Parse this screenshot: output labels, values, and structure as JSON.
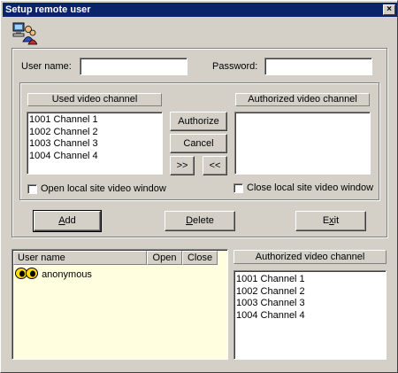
{
  "window": {
    "title": "Setup remote user",
    "close_glyph": "×"
  },
  "form": {
    "username_label": "User name:",
    "username_value": "",
    "password_label": "Password:",
    "password_value": ""
  },
  "used_channels": {
    "header": "Used video channel",
    "items": [
      "1001 Channel 1",
      "1002 Channel 2",
      "1003 Channel 3",
      "1004 Channel 4"
    ]
  },
  "authorized_channels_top": {
    "header": "Authorized video channel",
    "items": []
  },
  "middle_buttons": {
    "authorize": "Authorize",
    "cancel": "Cancel",
    "move_right": ">>",
    "move_left": "<<"
  },
  "checkboxes": {
    "open_local": "Open local site video window",
    "close_local": "Close local site video window"
  },
  "actions": {
    "add_underline": "A",
    "add_rest": "dd",
    "delete_underline": "D",
    "delete_rest": "elete",
    "exit_pre": "E",
    "exit_underline": "x",
    "exit_rest": "it"
  },
  "user_table": {
    "columns": [
      "User name",
      "Open",
      "Close"
    ],
    "rows": [
      {
        "name": "anonymous",
        "open": "",
        "close": ""
      }
    ]
  },
  "authorized_channels_bottom": {
    "header": "Authorized video channel",
    "items": [
      "1001 Channel 1",
      "1002 Channel 2",
      "1003 Channel 3",
      "1004 Channel 4"
    ]
  },
  "colors": {
    "titlebar": "#0a246a",
    "user_list_bg": "#ffffe0"
  },
  "icons": {
    "app": "users-computer-icon",
    "row": "eyes-icon"
  }
}
